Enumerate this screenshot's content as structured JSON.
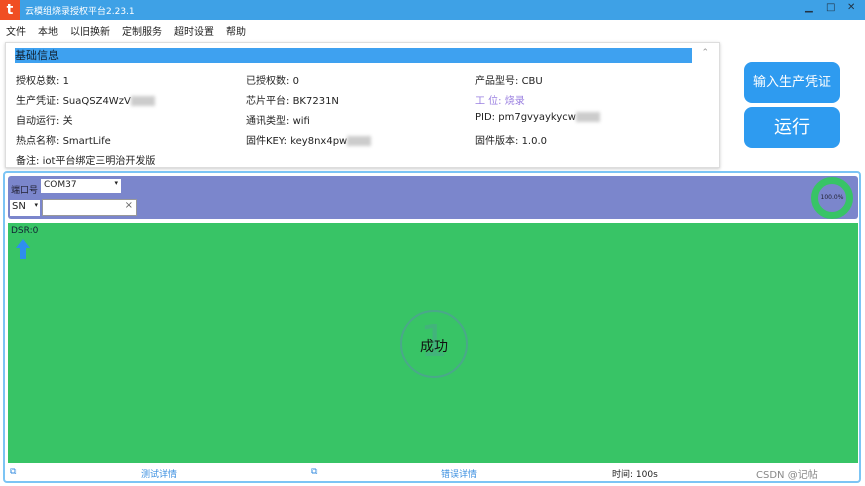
{
  "window": {
    "title": "云模组烧录授权平台2.23.1",
    "logo": "t",
    "minimize": "▁",
    "maximize": "□",
    "close": "✕"
  },
  "menu": [
    "文件",
    "本地",
    "以旧换新",
    "定制服务",
    "超时设置",
    "帮助"
  ],
  "info": {
    "header": "基础信息",
    "fields": [
      {
        "label": "授权总数:",
        "value": "1"
      },
      {
        "label": "已授权数:",
        "value": "0"
      },
      {
        "label": "产品型号:",
        "value": "CBU"
      },
      {
        "label": "生产凭证:",
        "value": "SuaQSZ4WzV"
      },
      {
        "label": "芯片平台:",
        "value": "BK7231N"
      },
      {
        "label": "工 位:",
        "value": "烧录"
      },
      {
        "label": "自动运行:",
        "value": "关"
      },
      {
        "label": "通讯类型:",
        "value": "wifi"
      },
      {
        "label": "PID:",
        "value": "pm7gvyaykycw"
      },
      {
        "label": "热点名称:",
        "value": "SmartLife"
      },
      {
        "label": "固件KEY:",
        "value": "key8nx4pw"
      },
      {
        "label": "固件版本:",
        "value": "1.0.0"
      },
      {
        "label": "备注:",
        "value": "iot平台绑定三明治开发版"
      }
    ]
  },
  "buttons": {
    "credential": "输入生产凭证",
    "run": "运行"
  },
  "control": {
    "port_label": "端口号",
    "port_value": "COM37",
    "sn_select": "SN",
    "sn_value": "",
    "clear": "×",
    "progress_text": "100.0%",
    "progress": 1.0
  },
  "work": {
    "dsr": "DSR:0",
    "result": "成功",
    "slot": "1"
  },
  "status": {
    "test_detail": "测试详情",
    "error_detail": "错误详情",
    "time": "时间:  100s",
    "watermark": "CSDN @记帖"
  },
  "colors": {
    "titlebar": "#3ea1e6",
    "control": "#7b86cc",
    "success": "#38c466",
    "accent": "#2e9bf0"
  }
}
